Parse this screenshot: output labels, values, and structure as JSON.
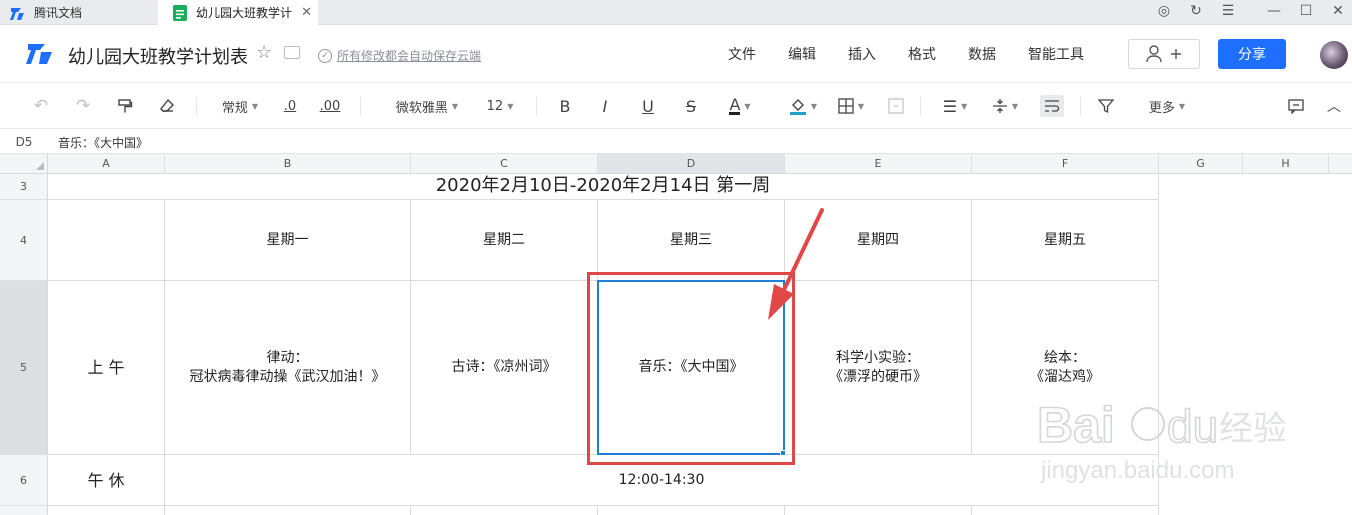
{
  "browser": {
    "tabs": [
      {
        "label": "腾讯文档"
      },
      {
        "label": "幼儿园大班教学计"
      }
    ]
  },
  "header": {
    "title": "幼儿园大班教学计划表",
    "autosave": "所有修改都会自动保存云端",
    "menus": [
      "文件",
      "编辑",
      "插入",
      "格式",
      "数据",
      "智能工具"
    ],
    "share_label": "分享"
  },
  "toolbar": {
    "number_format": "常规",
    "decimal_decrease": ".0",
    "decimal_increase": ".00",
    "font_family": "微软雅黑",
    "font_size": "12",
    "bold": "B",
    "italic": "I",
    "underline": "U",
    "strike": "S",
    "font_color": "A",
    "more": "更多",
    "font_color_hex": "#222222",
    "fill_color_hex": "#1ea0c8"
  },
  "formula_bar": {
    "cell_ref": "D5",
    "content": "音乐：《大中国》"
  },
  "columns": [
    "A",
    "B",
    "C",
    "D",
    "E",
    "F",
    "G",
    "H"
  ],
  "rows": [
    "3",
    "4",
    "5",
    "6"
  ],
  "sheet": {
    "title_row": "2020年2月10日-2020年2月14日         第一周",
    "weekdays": [
      "星期一",
      "星期二",
      "星期三",
      "星期四",
      "星期五"
    ],
    "morning_label": "上 午",
    "morning": [
      "律动：\n冠状病毒律动操《武汉加油！》",
      "古诗：《凉州词》",
      "音乐：《大中国》",
      "科学小实验：\n《漂浮的硬币》",
      "绘本：\n《溜达鸡》"
    ],
    "nap_label": "午 休",
    "nap_time": "12:00-14:30"
  },
  "selected_cell": "D5",
  "colors": {
    "accent": "#1e6fff",
    "selection": "#1d7fd6",
    "annotation": "#e04848"
  }
}
